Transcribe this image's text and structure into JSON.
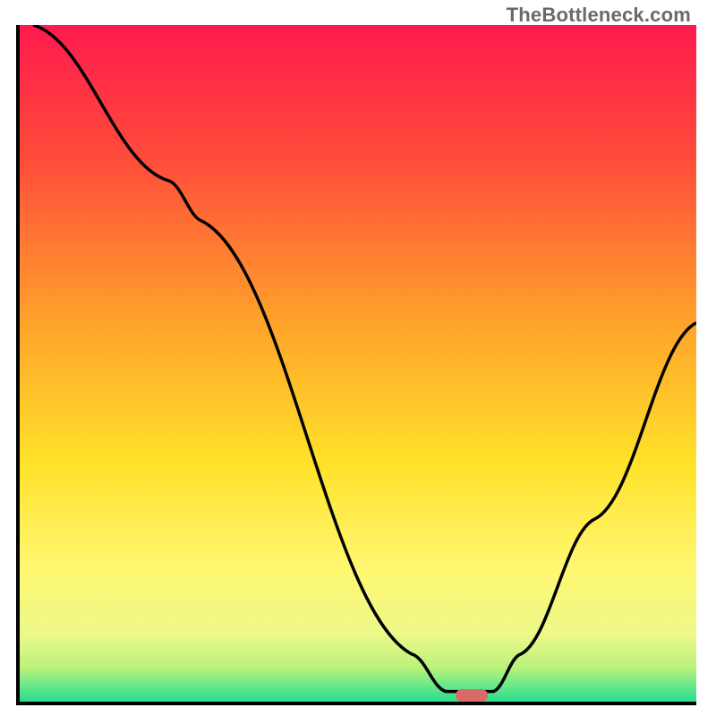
{
  "watermark": "TheBottleneck.com",
  "chart_data": {
    "type": "line",
    "title": "",
    "xlabel": "",
    "ylabel": "",
    "xlim": [
      0,
      100
    ],
    "ylim": [
      0,
      100
    ],
    "gradient_stops": [
      {
        "offset": 0.0,
        "color": "#ff1a4d"
      },
      {
        "offset": 0.2,
        "color": "#ff4d3a"
      },
      {
        "offset": 0.45,
        "color": "#ffa62a"
      },
      {
        "offset": 0.65,
        "color": "#ffe22a"
      },
      {
        "offset": 0.8,
        "color": "#fff770"
      },
      {
        "offset": 0.9,
        "color": "#eef98a"
      },
      {
        "offset": 0.95,
        "color": "#b9f27a"
      },
      {
        "offset": 0.975,
        "color": "#6de88a"
      },
      {
        "offset": 1.0,
        "color": "#29dd90"
      }
    ],
    "series": [
      {
        "name": "bottleneck-curve",
        "path_norm": [
          [
            0.02,
            0.0
          ],
          [
            0.22,
            0.23
          ],
          [
            0.27,
            0.29
          ],
          [
            0.58,
            0.93
          ],
          [
            0.63,
            0.985
          ],
          [
            0.7,
            0.985
          ],
          [
            0.74,
            0.93
          ],
          [
            0.85,
            0.73
          ],
          [
            1.0,
            0.44
          ]
        ]
      }
    ],
    "marker": {
      "name": "optimal-point",
      "x_norm": 0.665,
      "y_norm": 0.985,
      "color": "#d96a6a"
    }
  }
}
